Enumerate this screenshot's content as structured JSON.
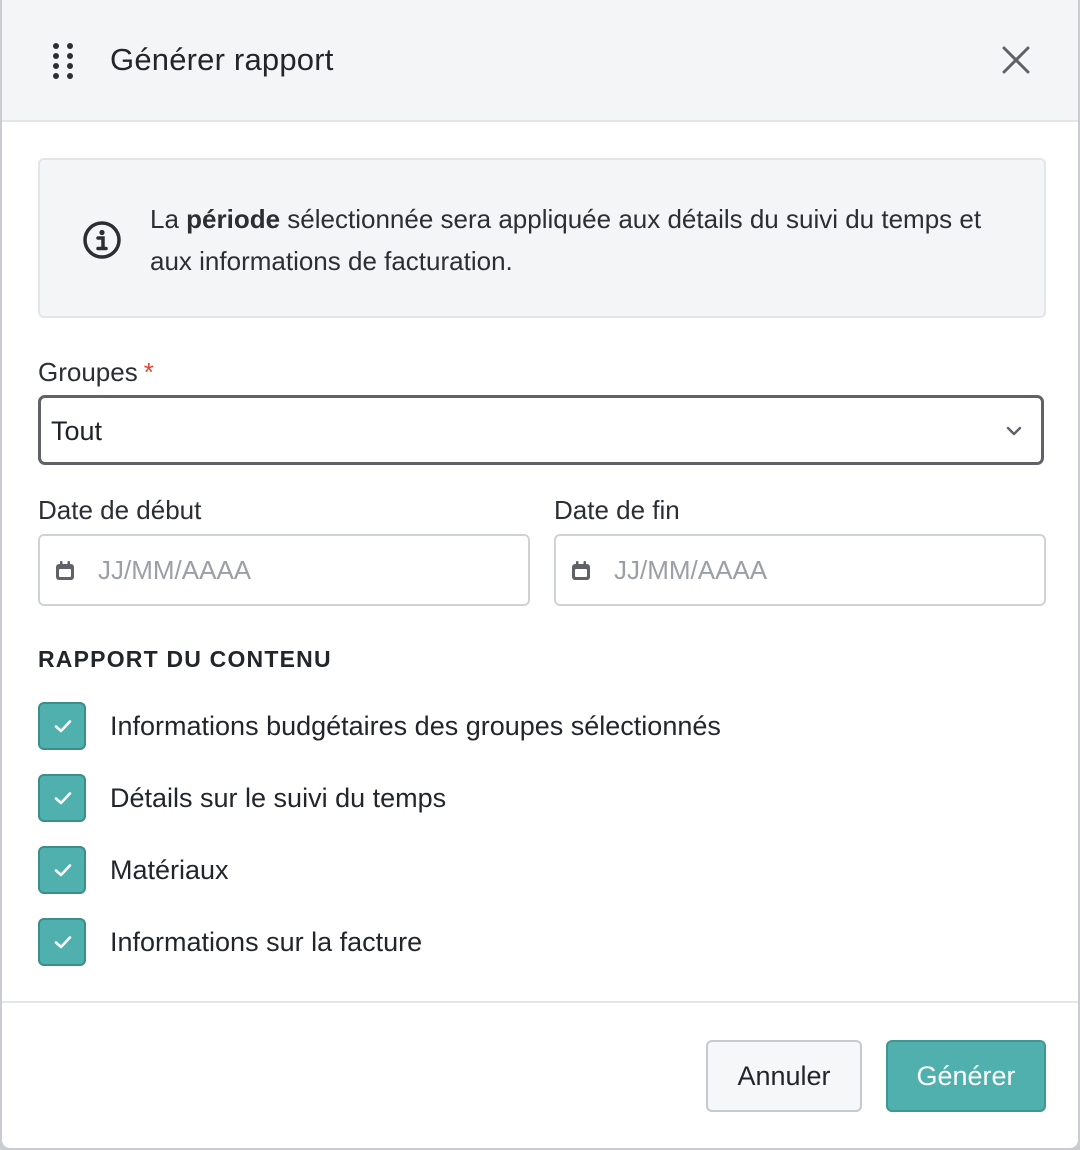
{
  "dialog": {
    "title": "Générer rapport",
    "icons": {
      "drag": "drag-handle-icon",
      "close": "close-icon"
    }
  },
  "info": {
    "icon": "info-icon",
    "text_before": "La ",
    "text_bold": "période",
    "text_after": " sélectionnée sera appliquée aux détails du suivi du temps et aux informations de facturation."
  },
  "groups": {
    "label": "Groupes",
    "required_marker": "*",
    "value": "Tout"
  },
  "start_date": {
    "label": "Date de début",
    "placeholder": "JJ/MM/AAAA",
    "value": ""
  },
  "end_date": {
    "label": "Date de fin",
    "placeholder": "JJ/MM/AAAA",
    "value": ""
  },
  "content": {
    "title": "RAPPORT DU CONTENU",
    "items": [
      {
        "label": "Informations budgétaires des groupes sélectionnés",
        "checked": true
      },
      {
        "label": "Détails sur le suivi du temps",
        "checked": true
      },
      {
        "label": "Matériaux",
        "checked": true
      },
      {
        "label": "Informations sur la facture",
        "checked": true
      }
    ]
  },
  "footer": {
    "cancel_label": "Annuler",
    "submit_label": "Générer"
  },
  "colors": {
    "accent": "#4fb0ad",
    "required": "#e0452f",
    "header_bg": "#f4f5f7"
  }
}
